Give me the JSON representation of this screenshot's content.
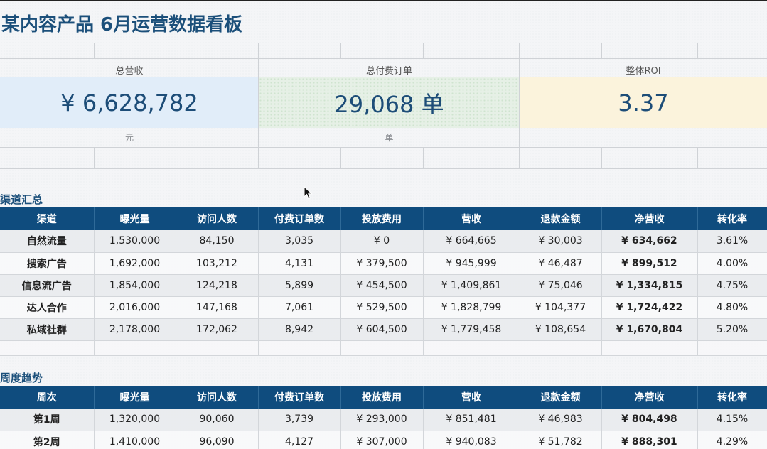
{
  "title": "某内容产品 6月运营数据看板",
  "kpis": [
    {
      "label": "总营收",
      "value": "¥ 6,628,782",
      "unit": "元",
      "color": "#e1edf9"
    },
    {
      "label": "总付费订单",
      "value": "29,068 单",
      "unit": "单",
      "color": "#e6f0e6"
    },
    {
      "label": "整体ROI",
      "value": "3.37",
      "unit": "",
      "color": "#fbf3dc"
    }
  ],
  "channel": {
    "section_title": "渠道汇总",
    "headers": [
      "渠道",
      "曝光量",
      "访问人数",
      "付费订单数",
      "投放费用",
      "营收",
      "退款金额",
      "净营收",
      "转化率"
    ],
    "rows": [
      [
        "自然流量",
        "1,530,000",
        "84,150",
        "3,035",
        "¥ 0",
        "¥ 664,665",
        "¥ 30,003",
        "¥ 634,662",
        "3.61%"
      ],
      [
        "搜索广告",
        "1,692,000",
        "103,212",
        "4,131",
        "¥ 379,500",
        "¥ 945,999",
        "¥ 46,487",
        "¥ 899,512",
        "4.00%"
      ],
      [
        "信息流广告",
        "1,854,000",
        "124,218",
        "5,899",
        "¥ 454,500",
        "¥ 1,409,861",
        "¥ 75,046",
        "¥ 1,334,815",
        "4.75%"
      ],
      [
        "达人合作",
        "2,016,000",
        "147,168",
        "7,061",
        "¥ 529,500",
        "¥ 1,828,799",
        "¥ 104,377",
        "¥ 1,724,422",
        "4.80%"
      ],
      [
        "私域社群",
        "2,178,000",
        "172,062",
        "8,942",
        "¥ 604,500",
        "¥ 1,779,458",
        "¥ 108,654",
        "¥ 1,670,804",
        "5.20%"
      ]
    ]
  },
  "weekly": {
    "section_title": "周度趋势",
    "headers": [
      "周次",
      "曝光量",
      "访问人数",
      "付费订单数",
      "投放费用",
      "营收",
      "退款金额",
      "净营收",
      "转化率"
    ],
    "rows": [
      [
        "第1周",
        "1,320,000",
        "90,060",
        "3,739",
        "¥ 293,000",
        "¥ 851,481",
        "¥ 46,983",
        "¥ 804,498",
        "4.15%"
      ],
      [
        "第2周",
        "1,410,000",
        "96,090",
        "4,127",
        "¥ 307,000",
        "¥ 940,083",
        "¥ 51,782",
        "¥ 888,301",
        "4.29%"
      ]
    ]
  },
  "colors": {
    "header_bg": "#0f4c7e",
    "title": "#1b4f7a",
    "kpi_value": "#1d4d78"
  }
}
